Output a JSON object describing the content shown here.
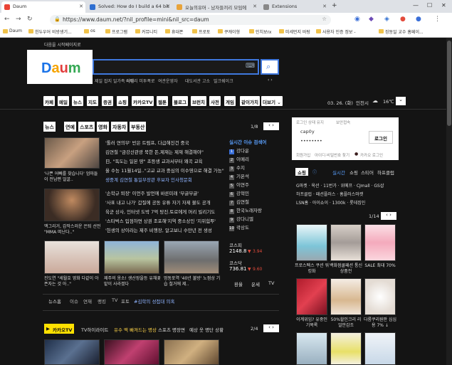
{
  "browser": {
    "tabs": [
      {
        "label": "Daum",
        "active": true
      },
      {
        "label": "Solved: How do I build a 64 bit",
        "active": false
      },
      {
        "label": "오늘의유머 - 남자들끼리 모임에",
        "active": false
      },
      {
        "label": "Extensions",
        "active": false
      }
    ],
    "url": "https://www.daum.net/?nil_profile=mini&nil_src=daum",
    "bookmarks": [
      "Daum",
      "힌두우어 비방생기...",
      "os",
      "프로그램",
      "커뮤니티",
      "휴대폰",
      "프로토",
      "쿠캐이형",
      "인치보rx",
      "미세먼지 바탕",
      "사용자 인증 정보 -",
      "징동일 교수 홈페이..."
    ]
  },
  "header": {
    "tagline": "다음을 시작페이지로",
    "logo_text": "Daum",
    "search_placeholder": "",
    "trends": [
      "제일 잡지 일가족 사망",
      "이메리 미투폭로",
      "여관운영자",
      "대도서관 고소",
      "밀크쉐이크"
    ]
  },
  "nav": {
    "items": [
      "카페",
      "메일",
      "뉴스",
      "지도",
      "증권",
      "쇼핑",
      "카카오TV",
      "웹툰",
      "블로그",
      "브런치",
      "사전",
      "게임",
      "같이가치",
      "더보기"
    ],
    "date": "03. 26. (화)",
    "city": "인천시",
    "weather_temp": "16℃"
  },
  "news": {
    "tabs": [
      "뉴스",
      "연예",
      "스포츠",
      "영화",
      "자동차",
      "부동산"
    ],
    "page": "1/8",
    "headlines": [
      "'톨러 연의부' 반은 트럼프, 다급해진건 중국",
      "김연철 \"금강산관광 북한 돈,제재는 제재 해결해야\"",
      "日, \"독도는 일본 땅\" 초등생 교과서부터 왜곡 교육",
      "올 수능 11월14일..\"고교 교과 중심의 이수영으로 해결 가능\"",
      "생중계 김연철 통일부장관 후보자 인사청문회",
      "'손학규 퇴장' 이언주 발언에 바른미래 '부글부글'",
      "'사표 내고 나가' 갑질에 공동 유튜 자기 자제 불도 공개",
      "육군 상사, 인터넷 도박 7억 탕진.토로에게 머리 빌리기도",
      "'스타벅스 입점하면 상권 조포해'지역 중소상인 '지위힘뿌'",
      "'헌생의 상이라는 제주 비행장, 알고보니 수만년 전 생성"
    ],
    "thumbs": [
      {
        "caption": "'나쁜 어빠를 찾습니다' 엄마들이 전남편 얼굴.."
      },
      {
        "caption": "맥그리거, 갑작스러운 은퇴 선언 \"MMA 떠난다..\""
      },
      {
        "caption": "진도연 \"세월호 영화 다같이 아픈자는 것 아..\""
      },
      {
        "caption": "제주의 옹소! 생산장을등 유채꽃밭이 사라졌다"
      },
      {
        "caption": "멍동포역 '40년 불방' 노점상 기습 철거에 제.."
      }
    ],
    "keywords_label": "뉴스홈",
    "keywords": [
      "이슈",
      "연재",
      "랭킹",
      "TV",
      "포토",
      "#김학의 성접대 의혹"
    ]
  },
  "realtime": {
    "title": "실시간 이슈 검색어",
    "items": [
      "강다운",
      "이메리",
      "수지",
      "기온석",
      "이연주",
      "강혁민",
      "김연철",
      "한국노래자랑",
      "강다니엘",
      "곽상도"
    ],
    "kospi_label": "코스피",
    "kospi_value": "2148.8",
    "kospi_change": "3.94",
    "kosdaq_label": "코스닥",
    "kosdaq_value": "736.81",
    "kosdaq_change": "9.60",
    "fin_tabs": [
      "환율",
      "운세",
      "TV"
    ]
  },
  "kakaotv": {
    "label": "카카오TV",
    "tabs": [
      "TV하이라이트",
      "유수 맥 빠져드는 명상",
      "스포츠 명장면",
      "예상 웃 명단 상황"
    ],
    "page": "2/4"
  },
  "login": {
    "save_label": "로그인 상태 유지",
    "security_label": "보안접속",
    "id_value": "cap0y",
    "pw_value": "••••••••",
    "button": "로그인",
    "links": [
      "회원가입",
      "아이디·비밀번호 찾기",
      "카카오 로그인"
    ]
  },
  "shopping": {
    "label": "쇼핑",
    "tabs": [
      "실시간",
      "쇼핑",
      "스티어",
      "하프클럽"
    ],
    "brand_lines": [
      "G마켓 · 옥션 · 11번가 · 위메프 · CJmall · GS샵",
      "하프클럽 · 패션플러스 · 홈플러스마켓",
      "LSN홈 · 아이쇼이 · 1300k · 롯데집인"
    ],
    "page": "1/14",
    "items": [
      {
        "caption": "프로스펙스 쿠션 워킹화"
      },
      {
        "caption": "백화점쿨패션 통신상품전"
      },
      {
        "caption": "SALE 최대 70%"
      },
      {
        "caption": "이계위임? 유중인기목록"
      },
      {
        "caption": "50%할인크리 리얼안감조"
      },
      {
        "caption": "다룸쿠리원판 심심용 7% ↓"
      }
    ]
  }
}
